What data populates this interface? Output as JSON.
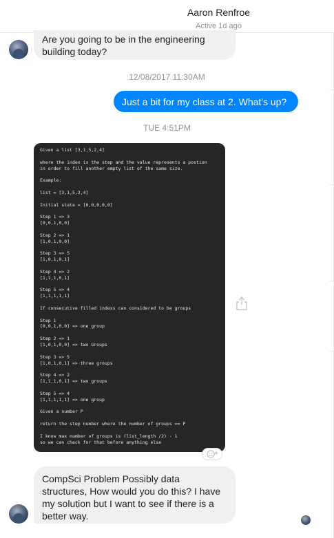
{
  "header": {
    "contact_name": "Aaron Renfroe",
    "status": "Active 1d ago"
  },
  "messages": {
    "m1": "Are you going to be in the engineering building today?",
    "ts1": "12/08/2017 11:30AM",
    "m2": "Just a bit for my class at 2. What's up?",
    "ts2": "TUE 4:51PM",
    "m3": "CompSci Problem Possibly data structures, How would you do this? I have my solution but I want to see if there is a better way."
  },
  "code_image": {
    "text": "Given a list [3,1,5,2,4]\n\nwhere the index is the step and the value represents a postion\nin order to fill another empty list of the same size.\n\nExample:\n\nlist = [3,1,5,2,4]\n\nInitial state = [0,0,0,0,0]\n\nStep 1 => 3\n[0,0,1,0,0]\n\nStep 2 => 1\n[1,0,1,0,0]\n\nStep 3 => 5\n[1,0,1,0,1]\n\nStep 4 => 2\n[1,1,1,0,1]\n\nStep 5 => 4\n[1,1,1,1,1]\n\nIf consecutive filled indexs can considered to be groups\n\nStep 1\n[0,0,1,0,0] => one group\n\nStep 2 => 1\n[1,0,1,0,0] => two Groups\n\nStep 3 => 5\n[1,0,1,0,1] => three groups\n\nStep 4 => 2\n[1,1,1,0,1] => two groups\n\nStep 5 => 4\n[1,1,1,1,1] => one group\n\nGiven a number P\n\nreturn the step number where the number of groups == P\n\nI know max number of groups is (list_length /2) - 1\nso we can check for that before anything else"
  },
  "icons": {
    "share": "share-icon",
    "reaction": "emoji-reaction-icon",
    "avatar": "avatar"
  },
  "colors": {
    "outgoing_bubble": "#0084ff",
    "incoming_bubble": "#f1f0f0",
    "code_background": "#262624"
  }
}
